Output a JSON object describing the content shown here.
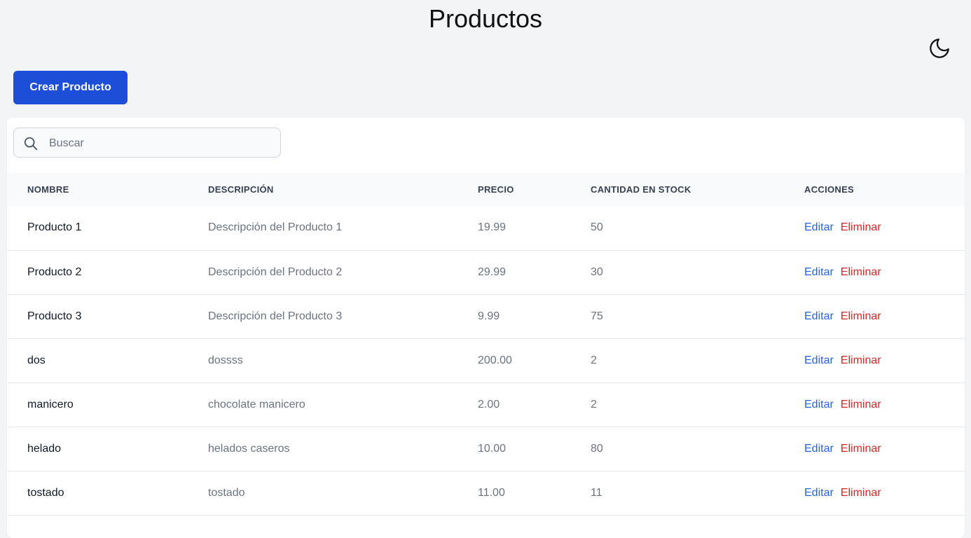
{
  "header": {
    "title": "Productos",
    "theme_toggle_icon": "moon-icon"
  },
  "toolbar": {
    "create_label": "Crear Producto"
  },
  "search": {
    "placeholder": "Buscar",
    "value": "",
    "icon": "search-icon"
  },
  "table": {
    "columns": [
      "NOMBRE",
      "DESCRIPCIÓN",
      "PRECIO",
      "CANTIDAD EN STOCK",
      "ACCIONES"
    ],
    "edit_label": "Editar",
    "delete_label": "Eliminar",
    "rows": [
      {
        "name": "Producto 1",
        "description": "Descripción del Producto 1",
        "price": "19.99",
        "stock": "50"
      },
      {
        "name": "Producto 2",
        "description": "Descripción del Producto 2",
        "price": "29.99",
        "stock": "30"
      },
      {
        "name": "Producto 3",
        "description": "Descripción del Producto 3",
        "price": "9.99",
        "stock": "75"
      },
      {
        "name": "dos",
        "description": "dossss",
        "price": "200.00",
        "stock": "2"
      },
      {
        "name": "manicero",
        "description": "chocolate manicero",
        "price": "2.00",
        "stock": "2"
      },
      {
        "name": "helado",
        "description": "helados caseros",
        "price": "10.00",
        "stock": "80"
      },
      {
        "name": "tostado",
        "description": "tostado",
        "price": "11.00",
        "stock": "11"
      }
    ]
  },
  "colors": {
    "primary": "#1d4ed8",
    "edit": "#2563eb",
    "delete": "#dc2626",
    "background": "#f3f4f6"
  }
}
